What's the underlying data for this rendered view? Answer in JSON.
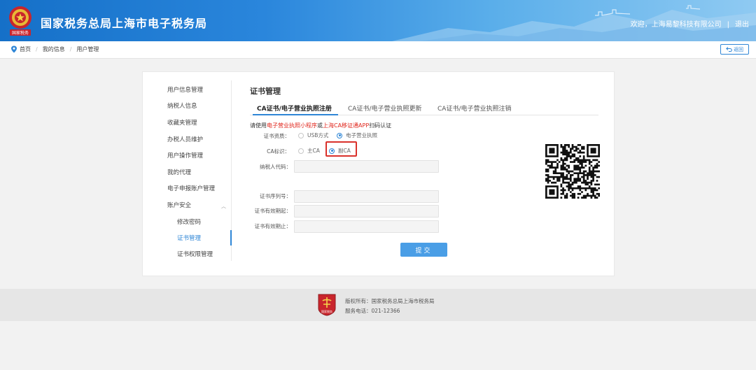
{
  "header": {
    "emblem_text": "国家税务",
    "site_title": "国家税务总局上海市电子税务局",
    "welcome": "欢迎，",
    "company": "上海易黎科技有限公司",
    "separator": "|",
    "logout": "退出"
  },
  "breadcrumb": {
    "items": [
      "首页",
      "我的信息",
      "用户管理"
    ],
    "back_label": "返回"
  },
  "menu": {
    "items": [
      {
        "label": "用户信息管理"
      },
      {
        "label": "纳税人信息"
      },
      {
        "label": "收藏夹管理"
      },
      {
        "label": "办税人员维护"
      },
      {
        "label": "用户操作管理"
      },
      {
        "label": "我的代理"
      },
      {
        "label": "电子申报账户管理"
      },
      {
        "label": "账户安全"
      },
      {
        "label": "修改密码"
      },
      {
        "label": "证书管理"
      },
      {
        "label": "证书权限管理"
      }
    ],
    "active": "证书管理"
  },
  "panel": {
    "title": "证书管理",
    "tabs": [
      {
        "label": "CA证书/电子营业执照注册",
        "active": true
      },
      {
        "label": "CA证书/电子营业执照更新",
        "active": false
      },
      {
        "label": "CA证书/电子营业执照注销",
        "active": false
      }
    ],
    "notice": {
      "prefix": "请使用",
      "red1": "电子营业执照小程序",
      "middle": "或",
      "red2": "上海CA移证通APP",
      "suffix": "扫码认证"
    },
    "cert_source": {
      "label": "证书资质：",
      "options": [
        "USB方式",
        "电子营业执照"
      ],
      "selected": "电子营业执照"
    },
    "ca_type": {
      "label": "CA标识：",
      "options": [
        "主CA",
        "副CA"
      ],
      "selected": "副CA"
    },
    "fields": [
      {
        "label": "纳税人代码：",
        "value": ""
      },
      {
        "label": "证书序列号：",
        "value": ""
      },
      {
        "label": "证书有效期起：",
        "value": ""
      },
      {
        "label": "证书有效期止：",
        "value": ""
      }
    ],
    "submit_label": "提交"
  },
  "footer": {
    "copyright": "版权所有：国家税务总局上海市税务局",
    "phone": "服务电话：021-12366",
    "logo_text": "国家税务"
  },
  "colors": {
    "accent": "#2f86d6",
    "header_start": "#1570c8",
    "highlight": "#d9312b",
    "notice_red": "#e0261c"
  }
}
